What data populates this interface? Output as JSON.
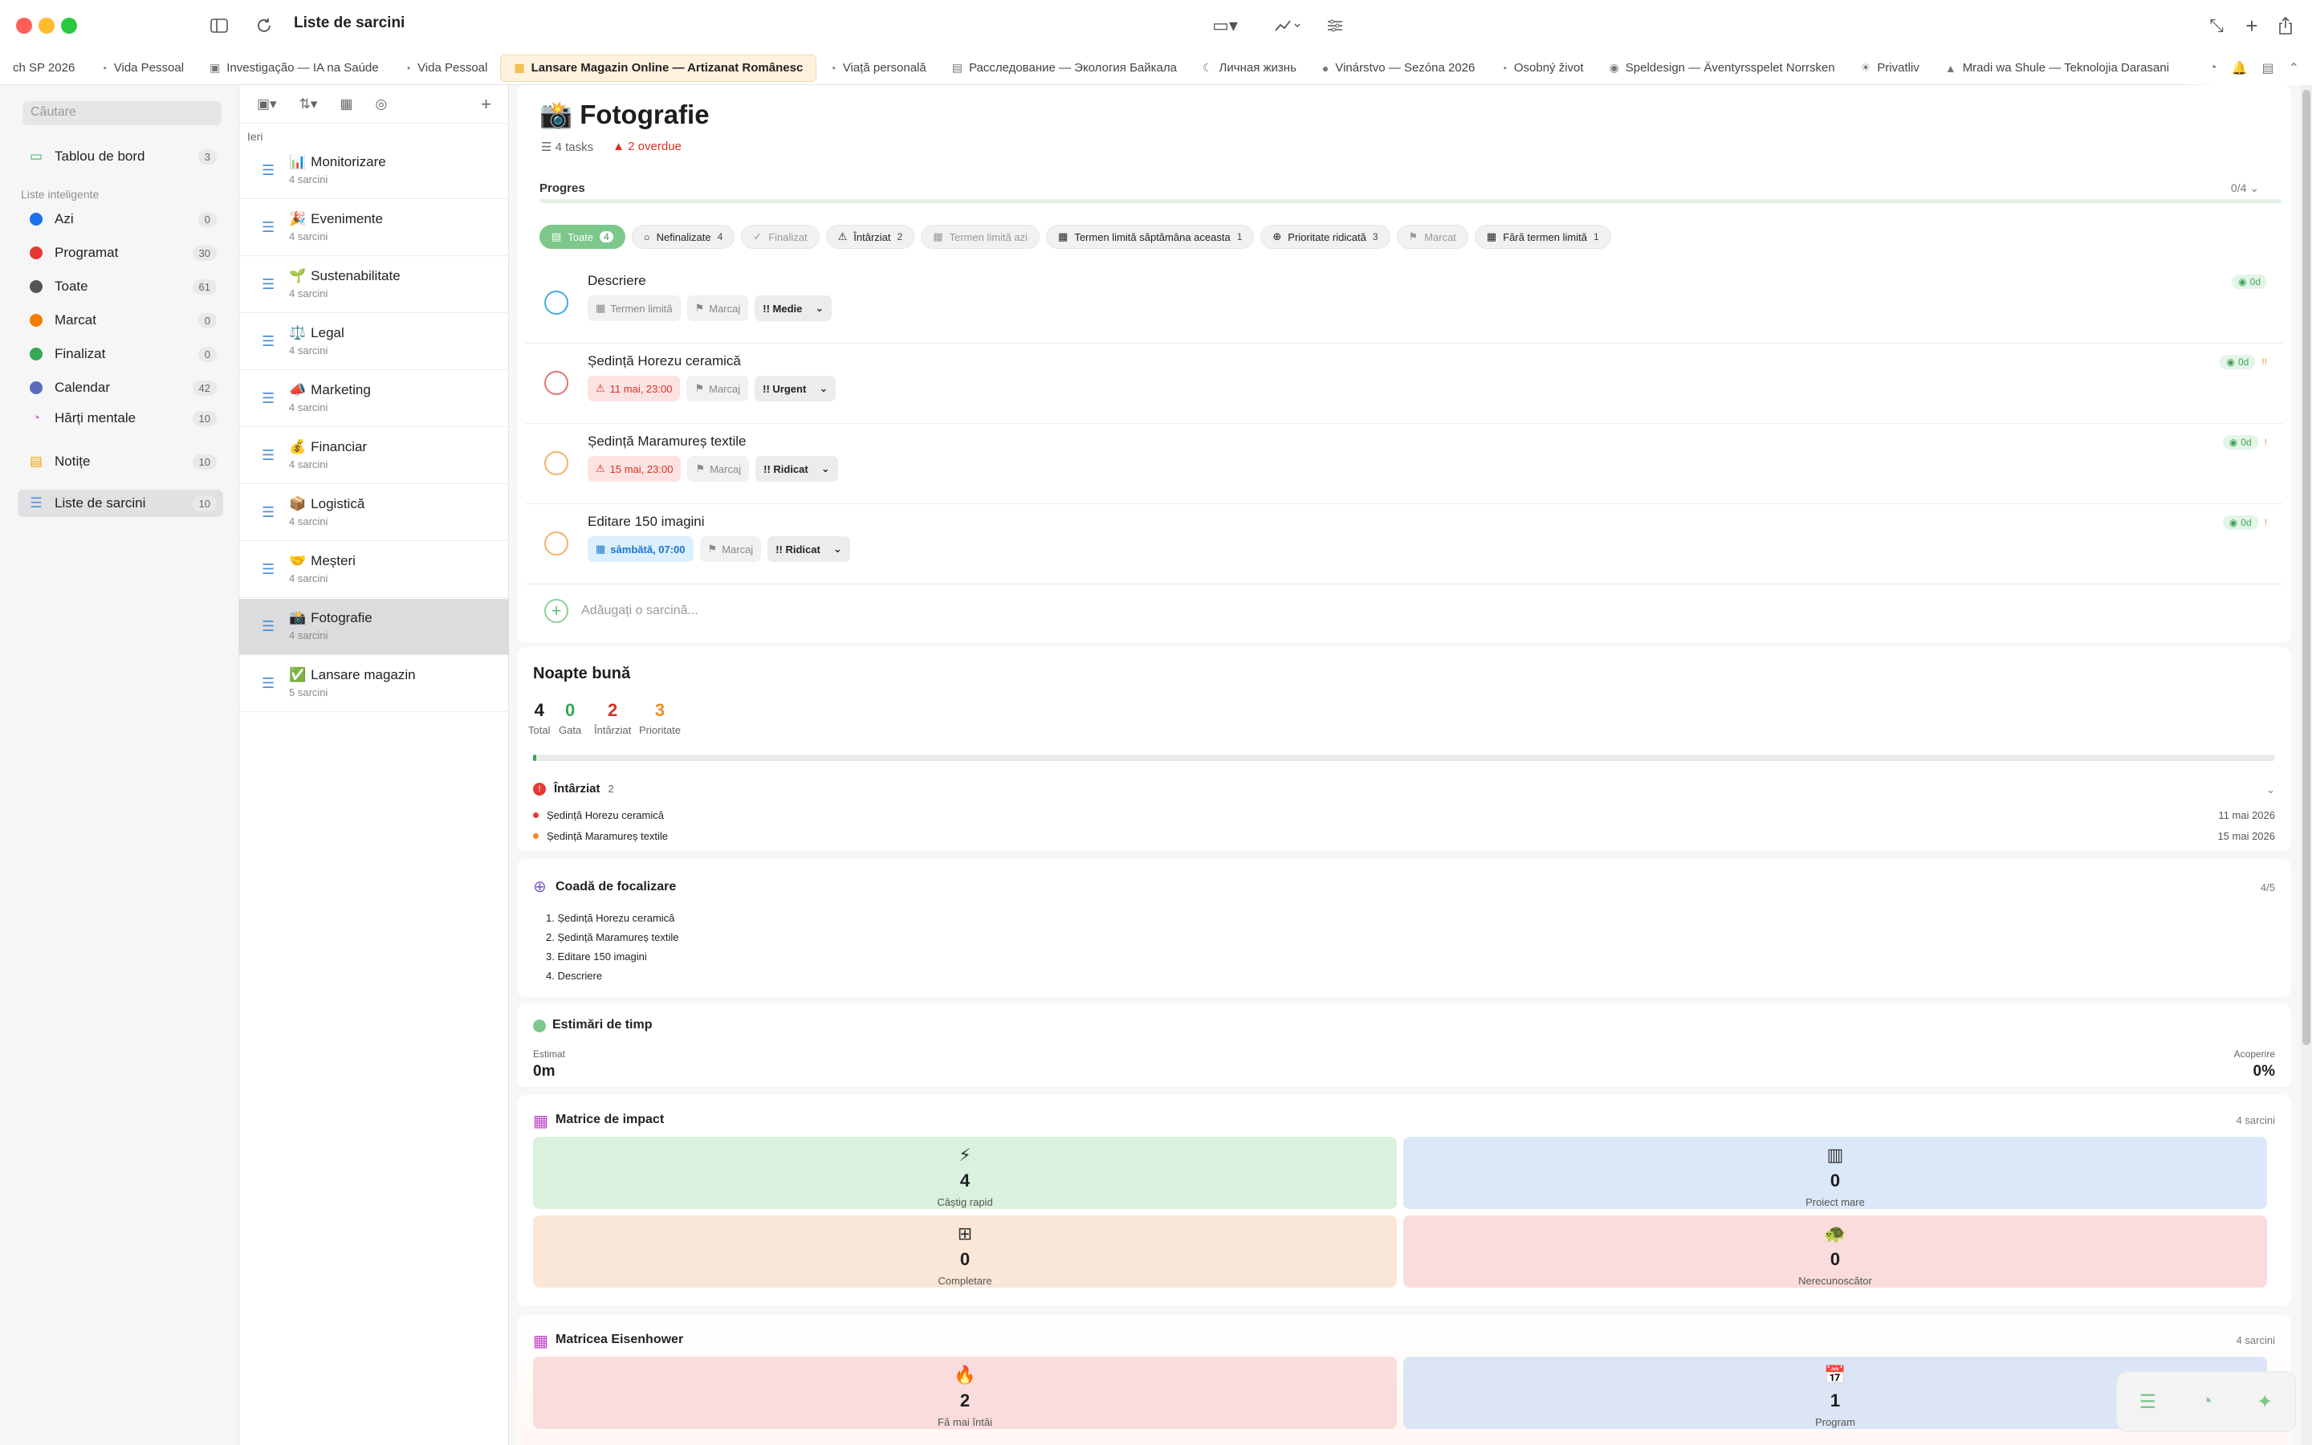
{
  "window": {
    "title": "Liste de sarcini"
  },
  "tabs": [
    {
      "label": "ch SP 2026",
      "icon": ""
    },
    {
      "label": "Vida Pessoal",
      "icon": "mind-icon"
    },
    {
      "label": "Investigação — IA na Saúde",
      "icon": "briefcase-icon"
    },
    {
      "label": "Vida Pessoal",
      "icon": "mind-icon"
    },
    {
      "label": "Lansare Magazin Online — Artizanat Românesc",
      "icon": "shop-icon",
      "active": true
    },
    {
      "label": "Viață personală",
      "icon": "mind-icon"
    },
    {
      "label": "Расследование — Экология Байкала",
      "icon": "doc-icon"
    },
    {
      "label": "Личная жизнь",
      "icon": "moon-icon"
    },
    {
      "label": "Vinárstvo — Sezóna 2026",
      "icon": "pin-icon"
    },
    {
      "label": "Osobný život",
      "icon": "mind-icon"
    },
    {
      "label": "Speldesign — Äventyrsspelet Norrsken",
      "icon": "gamepad-icon"
    },
    {
      "label": "Privatliv",
      "icon": "sun-icon"
    },
    {
      "label": "Mradi wa Shule — Teknolojia Darasani",
      "icon": "cap-icon"
    }
  ],
  "sidebar": {
    "search_placeholder": "Căutare",
    "dashboard": {
      "label": "Tablou de bord",
      "count": "3"
    },
    "smart_lists_title": "Liste inteligente",
    "smart": [
      {
        "label": "Azi",
        "count": "0",
        "color": "#1a73e8"
      },
      {
        "label": "Programat",
        "count": "30",
        "color": "#e53935"
      },
      {
        "label": "Toate",
        "count": "61",
        "color": "#555555"
      },
      {
        "label": "Marcat",
        "count": "0",
        "color": "#f57c00"
      },
      {
        "label": "Finalizat",
        "count": "0",
        "color": "#34a853"
      },
      {
        "label": "Calendar",
        "count": "42",
        "color": "#5c6bc0"
      }
    ],
    "mindmaps": {
      "label": "Hărți mentale",
      "count": "10"
    },
    "notes": {
      "label": "Notițe",
      "count": "10"
    },
    "tasklists": {
      "label": "Liste de sarcini",
      "count": "10"
    }
  },
  "list": {
    "group": "Ieri",
    "items": [
      {
        "emoji": "📊",
        "title": "Monitorizare",
        "sub": "4 sarcini"
      },
      {
        "emoji": "🎉",
        "title": "Evenimente",
        "sub": "4 sarcini"
      },
      {
        "emoji": "🌱",
        "title": "Sustenabilitate",
        "sub": "4 sarcini"
      },
      {
        "emoji": "⚖️",
        "title": "Legal",
        "sub": "4 sarcini"
      },
      {
        "emoji": "📣",
        "title": "Marketing",
        "sub": "4 sarcini"
      },
      {
        "emoji": "💰",
        "title": "Financiar",
        "sub": "4 sarcini"
      },
      {
        "emoji": "📦",
        "title": "Logistică",
        "sub": "4 sarcini"
      },
      {
        "emoji": "🤝",
        "title": "Meșteri",
        "sub": "4 sarcini"
      },
      {
        "emoji": "📸",
        "title": "Fotografie",
        "sub": "4 sarcini"
      },
      {
        "emoji": "✅",
        "title": "Lansare magazin",
        "sub": "5 sarcini"
      }
    ]
  },
  "main": {
    "title": "📸 Fotografie",
    "tasks_meta": "4 tasks",
    "overdue_meta": "2 overdue",
    "progress_label": "Progres",
    "progress_count": "0/4",
    "progress_fraction": 0,
    "filters": [
      {
        "label": "Toate",
        "n": "4",
        "active": true
      },
      {
        "label": "Nefinalizate",
        "n": "4",
        "icon": "○"
      },
      {
        "label": "Finalizat",
        "n": "",
        "icon": "✓",
        "muted": true
      },
      {
        "label": "Întârziat",
        "n": "2",
        "icon": "⚠"
      },
      {
        "label": "Termen limită azi",
        "n": "",
        "icon": "▦",
        "muted": true
      },
      {
        "label": "Termen limită săptămâna aceasta",
        "n": "1",
        "icon": "▦"
      },
      {
        "label": "Prioritate ridicată",
        "n": "3",
        "icon": "⊕"
      },
      {
        "label": "Marcat",
        "n": "",
        "icon": "⚑",
        "muted": true
      },
      {
        "label": "Fără termen limită",
        "n": "1",
        "icon": "▦"
      }
    ],
    "tasks": [
      {
        "title": "Descriere",
        "date": "Termen limită",
        "date_kind": "none",
        "flag": "Marcaj",
        "priority": "!! Medie",
        "badge": "0d",
        "ring": "#4aa8e0",
        "extra": ""
      },
      {
        "title": "Ședință Horezu ceramică",
        "date": "11 mai, 23:00",
        "date_kind": "overdue",
        "flag": "Marcaj",
        "priority": "!! Urgent",
        "badge": "0d",
        "ring": "#e57373",
        "extra": "!!"
      },
      {
        "title": "Ședință Maramureș textile",
        "date": "15 mai, 23:00",
        "date_kind": "overdue",
        "flag": "Marcaj",
        "priority": "!! Ridicat",
        "badge": "0d",
        "ring": "#f0b26a",
        "extra": "!"
      },
      {
        "title": "Editare 150 imagini",
        "date": "sâmbătă, 07:00",
        "date_kind": "upcoming",
        "flag": "Marcaj",
        "priority": "!! Ridicat",
        "badge": "0d",
        "ring": "#f0b26a",
        "extra": "!"
      }
    ],
    "add_task_placeholder": "Adăugați o sarcină..."
  },
  "summary": {
    "title": "Noapte bună",
    "stats": [
      {
        "v": "4",
        "l": "Total",
        "color": "#1d1d1f"
      },
      {
        "v": "0",
        "l": "Gata",
        "color": "#34a853"
      },
      {
        "v": "2",
        "l": "Întârziat",
        "color": "#d93025"
      },
      {
        "v": "3",
        "l": "Prioritate",
        "color": "#f08a24"
      }
    ],
    "overdue_title": "Întârziat",
    "overdue_count": "2",
    "overdue_items": [
      {
        "title": "Ședință Horezu ceramică",
        "date": "11 mai 2026",
        "color": "#e53935"
      },
      {
        "title": "Ședință Maramureș textile",
        "date": "15 mai 2026",
        "color": "#f08a24"
      }
    ]
  },
  "focus": {
    "title": "Coadă de focalizare",
    "count": "4/5",
    "items": [
      "1.  Ședință Horezu ceramică",
      "2.  Ședință Maramureș textile",
      "3.  Editare 150 imagini",
      "4.  Descriere"
    ]
  },
  "time": {
    "title": "Estimări de timp",
    "est_label": "Estimat",
    "est_value": "0m",
    "cov_label": "Acoperire",
    "cov_value": "0%"
  },
  "impact": {
    "title": "Matrice de impact",
    "count": "4 sarcini",
    "quads": [
      {
        "icon": "⚡",
        "v": "4",
        "l": "Câștig rapid",
        "bg": "#d9f1dd"
      },
      {
        "icon": "▥",
        "v": "0",
        "l": "Proiect mare",
        "bg": "#dbe8f9"
      },
      {
        "icon": "⊞",
        "v": "0",
        "l": "Completare",
        "bg": "#fbe7d7"
      },
      {
        "icon": "🐢",
        "v": "0",
        "l": "Nerecunoscător",
        "bg": "#fadcdc"
      }
    ]
  },
  "eisenhower": {
    "title": "Matricea Eisenhower",
    "count": "4 sarcini",
    "quads": [
      {
        "icon": "🔥",
        "v": "2",
        "l": "Fă mai întâi",
        "bg": "#fadcdc"
      },
      {
        "icon": "📅",
        "v": "1",
        "l": "Program",
        "bg": "#dbe5f5"
      }
    ]
  }
}
